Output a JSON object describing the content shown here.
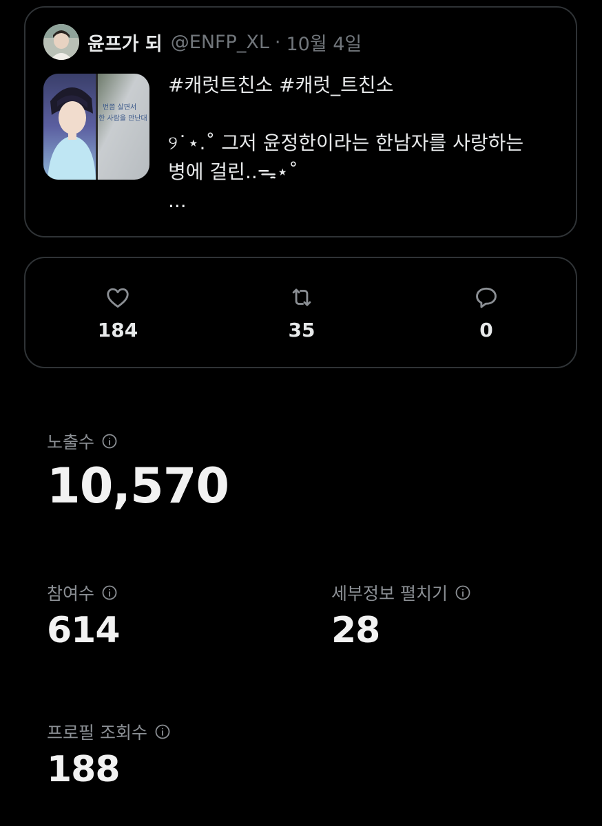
{
  "quoted_post": {
    "author_name": "윤프가 되",
    "author_handle": "@ENFP_XL",
    "separator": "·",
    "date": "10월 4일",
    "text_lines": [
      "#캐럿트친소 #캐럿_트친소",
      "",
      "୨˙⋆.˚ 그저 윤정한이라는 한남자를 사랑하는",
      "병에 걸린..ᯓ⋆˚",
      "..."
    ],
    "thumbnail_caption_1": "번쯤 살면서",
    "thumbnail_caption_2": "한 사람을 만난대"
  },
  "engagement": {
    "likes": {
      "icon": "heart-icon",
      "count": "184"
    },
    "reposts": {
      "icon": "repost-icon",
      "count": "35"
    },
    "replies": {
      "icon": "reply-icon",
      "count": "0"
    }
  },
  "metrics": {
    "impressions": {
      "label": "노출수",
      "value": "10,570"
    },
    "engagements": {
      "label": "참여수",
      "value": "614"
    },
    "detail_expands": {
      "label": "세부정보 펼치기",
      "value": "28"
    },
    "profile_visits": {
      "label": "프로필 조회수",
      "value": "188"
    }
  },
  "colors": {
    "background": "#000000",
    "border": "#2f3336",
    "secondary_text": "#71767b",
    "primary_text": "#e7e9ea"
  }
}
